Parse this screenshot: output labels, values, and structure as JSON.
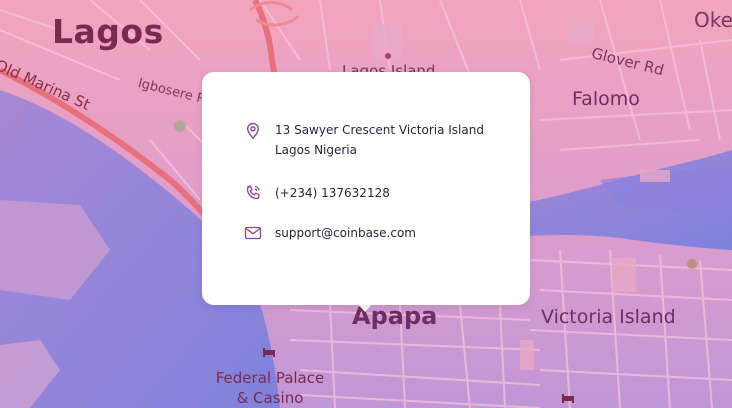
{
  "map": {
    "labels": {
      "city": "Lagos",
      "okep": "Okep",
      "glover_rd": "Glover Rd",
      "falomo": "Falomo",
      "old_marina_st": "Old Marina St",
      "igbosere": "Igbosere R",
      "lagos_island": "Lagos Island",
      "apapa": "Apapa",
      "victoria_island": "Victoria Island",
      "federal_palace": "Federal Palace & Casino"
    },
    "colors": {
      "land_top": "#f0a0bc",
      "land_bottom": "#b98fd2",
      "water": "#8a7fd8",
      "main_road": "#e8707a",
      "card": "#ffffff",
      "icon_accent": "#8e3fa8"
    }
  },
  "contact": {
    "address": "13 Sawyer Crescent Victoria Island Lagos Nigeria",
    "phone": "(+234) 137632128",
    "email": "support@coinbase.com",
    "icons": [
      "location-pin-icon",
      "phone-icon",
      "mail-icon"
    ]
  }
}
